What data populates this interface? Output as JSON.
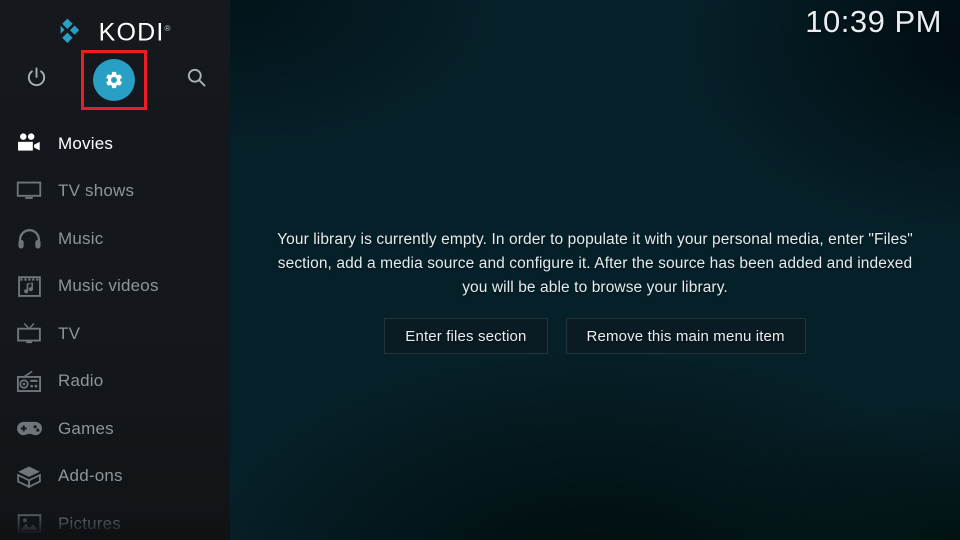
{
  "app": {
    "name": "KODI",
    "trademark": "®",
    "logo_color": "#2a9fc4",
    "accent_color": "#2a9fc4",
    "annotation_color": "#ee1c23"
  },
  "topbar": {
    "clock": "10:39 PM",
    "icons": [
      {
        "name": "power-icon",
        "label": "Power"
      },
      {
        "name": "settings-gear-icon",
        "label": "Settings",
        "highlighted": true
      },
      {
        "name": "search-icon",
        "label": "Search"
      }
    ]
  },
  "sidebar": {
    "items": [
      {
        "label": "Movies",
        "icon": "movies-icon",
        "state": "selected"
      },
      {
        "label": "TV shows",
        "icon": "tv-shows-icon",
        "state": "dim"
      },
      {
        "label": "Music",
        "icon": "music-icon",
        "state": "dim"
      },
      {
        "label": "Music videos",
        "icon": "music-videos-icon",
        "state": "dim"
      },
      {
        "label": "TV",
        "icon": "tv-icon",
        "state": "dim"
      },
      {
        "label": "Radio",
        "icon": "radio-icon",
        "state": "dim"
      },
      {
        "label": "Games",
        "icon": "games-icon",
        "state": "dim"
      },
      {
        "label": "Add-ons",
        "icon": "add-ons-icon",
        "state": "dim"
      },
      {
        "label": "Pictures",
        "icon": "pictures-icon",
        "state": "faded"
      }
    ]
  },
  "main": {
    "empty_message": "Your library is currently empty. In order to populate it with your personal media, enter \"Files\" section, add a media source and configure it. After the source has been added and indexed you will be able to browse your library.",
    "buttons": [
      {
        "label": "Enter files section",
        "name": "enter-files-section-button"
      },
      {
        "label": "Remove this main menu item",
        "name": "remove-main-menu-item-button"
      }
    ]
  }
}
